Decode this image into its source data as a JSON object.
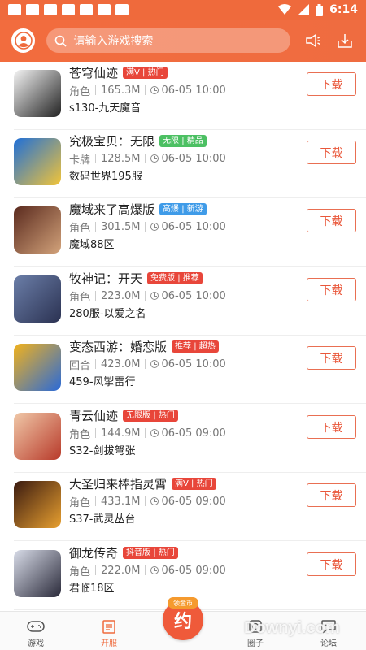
{
  "status": {
    "time": "6:14"
  },
  "search": {
    "placeholder": "请输入游戏搜索"
  },
  "items": [
    {
      "title": "苍穹仙迹",
      "tags": [
        {
          "text": "满V | 热门",
          "color": "#e8463a"
        }
      ],
      "category": "角色",
      "size": "165.3M",
      "time": "06-05 10:00",
      "server": "s130-九天魔音",
      "button": "下载",
      "thumb_colors": [
        "#f4f4f4",
        "#222222"
      ]
    },
    {
      "title": "究极宝贝：无限",
      "tags": [
        {
          "text": "无限 | 精品",
          "color": "#4cc063"
        }
      ],
      "category": "卡牌",
      "size": "128.5M",
      "time": "06-05 10:00",
      "server": "数码世界195服",
      "button": "下载",
      "thumb_colors": [
        "#1f6fd8",
        "#f2c438"
      ]
    },
    {
      "title": "魔域来了高爆版",
      "tags": [
        {
          "text": "高爆 | 新游",
          "color": "#3f9be8"
        }
      ],
      "category": "角色",
      "size": "301.5M",
      "time": "06-05 10:00",
      "server": "魔域88区",
      "button": "下载",
      "thumb_colors": [
        "#5a2a1e",
        "#d2a27a"
      ]
    },
    {
      "title": "牧神记：开天",
      "tags": [
        {
          "text": "免费版 | 推荐",
          "color": "#e8463a"
        }
      ],
      "category": "角色",
      "size": "223.0M",
      "time": "06-05 10:00",
      "server": "280服-以爱之名",
      "button": "下载",
      "thumb_colors": [
        "#6b7ea8",
        "#2b3252"
      ]
    },
    {
      "title": "变态西游：婚恋版",
      "tags": [
        {
          "text": "推荐 | 超热",
          "color": "#e8463a"
        }
      ],
      "category": "回合",
      "size": "423.0M",
      "time": "06-05 10:00",
      "server": "459-风掣雷行",
      "button": "下载",
      "thumb_colors": [
        "#f2b21c",
        "#2a6ad8"
      ]
    },
    {
      "title": "青云仙迹",
      "tags": [
        {
          "text": "无限版 | 热门",
          "color": "#e8463a"
        }
      ],
      "category": "角色",
      "size": "144.9M",
      "time": "06-05 09:00",
      "server": "S32-剑拔弩张",
      "button": "下载",
      "thumb_colors": [
        "#f0c8a8",
        "#b83a2a"
      ]
    },
    {
      "title": "大圣归来棒指灵霄",
      "tags": [
        {
          "text": "满V | 热门",
          "color": "#e8463a"
        }
      ],
      "category": "角色",
      "size": "433.1M",
      "time": "06-05 09:00",
      "server": "S37-武灵丛台",
      "button": "下载",
      "thumb_colors": [
        "#3a1a10",
        "#e8a030"
      ]
    },
    {
      "title": "御龙传奇",
      "tags": [
        {
          "text": "抖音版 | 热门",
          "color": "#e8463a"
        }
      ],
      "category": "角色",
      "size": "222.0M",
      "time": "06-05 09:00",
      "server": "君临18区",
      "button": "下载",
      "thumb_colors": [
        "#d8dce8",
        "#2a2a3a"
      ]
    }
  ],
  "nav": {
    "tabs": [
      {
        "label": "游戏",
        "icon": "gamepad-icon"
      },
      {
        "label": "开服",
        "icon": "calendar-icon"
      },
      {
        "label": "圈子",
        "icon": "circle-icon"
      },
      {
        "label": "论坛",
        "icon": "forum-icon"
      }
    ],
    "center_badge": "领金币",
    "center_label": "约"
  },
  "watermark": "Downyi.com",
  "colors": {
    "accent": "#ef6a3c",
    "tag_red": "#e8463a",
    "button_red": "#e9573a"
  }
}
